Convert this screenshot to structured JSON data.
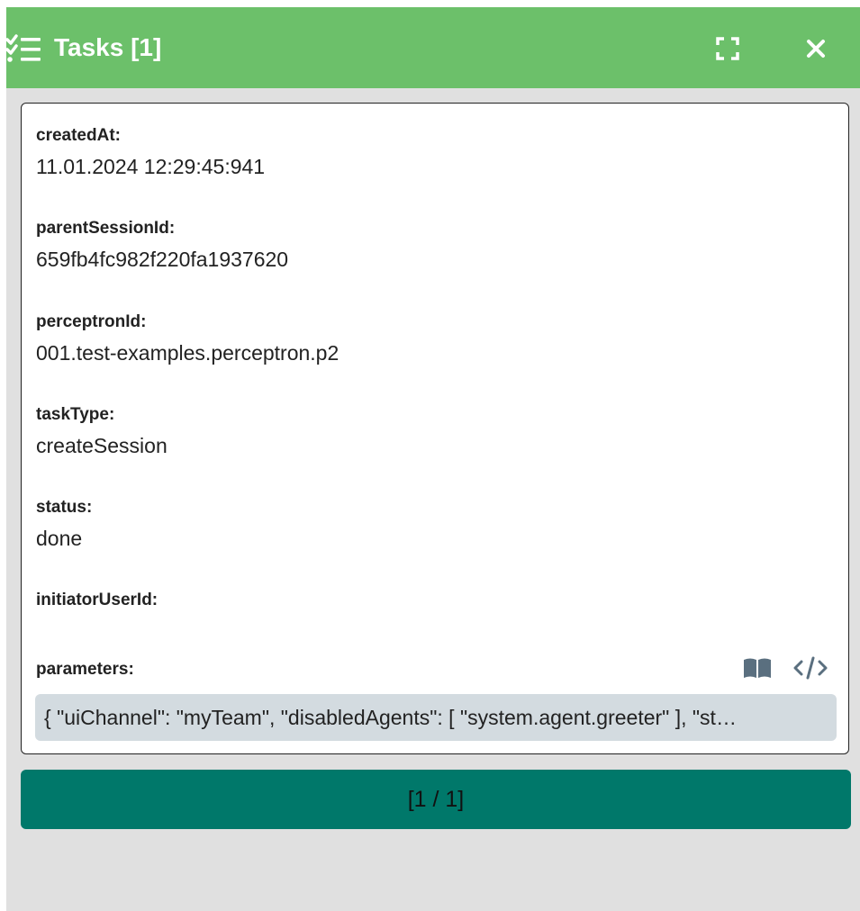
{
  "window": {
    "title": "Tasks [1]",
    "header_color": "#6cc06a",
    "header_icon": "checklist-icon",
    "fullscreen_icon": "fullscreen-icon",
    "close_icon": "close-icon"
  },
  "fields": [
    {
      "label": "createdAt:",
      "value": "11.01.2024 12:29:45:941"
    },
    {
      "label": "parentSessionId:",
      "value": "659fb4fc982f220fa1937620"
    },
    {
      "label": "perceptronId:",
      "value": "001.test-examples.perceptron.p2"
    },
    {
      "label": "taskType:",
      "value": "createSession"
    },
    {
      "label": "status:",
      "value": "done"
    },
    {
      "label": "initiatorUserId:",
      "value": ""
    }
  ],
  "parameters": {
    "label": "parameters:",
    "value": "{ \"uiChannel\": \"myTeam\", \"disabledAgents\": [ \"system.agent.greeter\" ], \"st…",
    "book_icon": "book-icon",
    "code_icon": "code-icon"
  },
  "pager": {
    "label": "[1 / 1]",
    "color": "#00786a"
  }
}
